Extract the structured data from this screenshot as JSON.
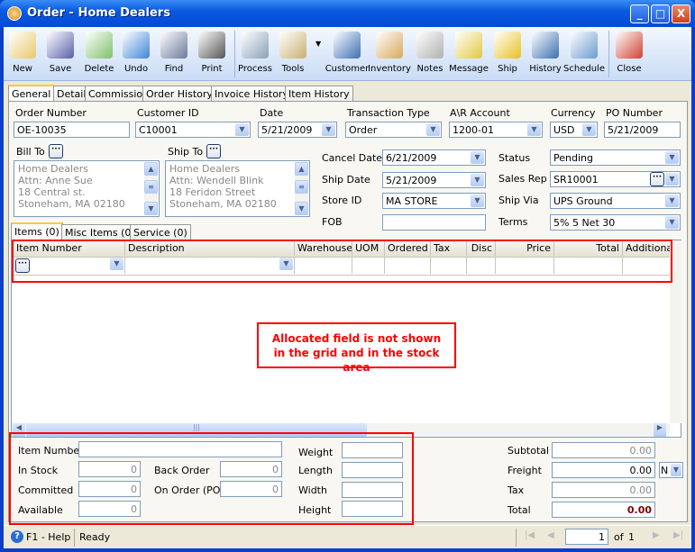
{
  "window": {
    "title": "Order - Home Dealers",
    "minimize": "_",
    "maximize": "□",
    "close": "X"
  },
  "toolbar": [
    {
      "label": "New",
      "icon": "new-document-icon",
      "color": "#e8c96a"
    },
    {
      "label": "Save",
      "icon": "floppy-disk-icon",
      "color": "#5a5fa8"
    },
    {
      "label": "Delete",
      "icon": "recycle-bin-icon",
      "color": "#7fbf6a"
    },
    {
      "label": "Undo",
      "icon": "undo-arrow-icon",
      "color": "#3f86d8"
    },
    {
      "label": "Find",
      "icon": "binoculars-icon",
      "color": "#6a7a9a"
    },
    {
      "label": "Print",
      "icon": "printer-icon",
      "color": "#555"
    },
    {
      "label": "Process",
      "icon": "process-gear-icon",
      "color": "#8aa0b8"
    },
    {
      "label": "Tools",
      "icon": "tools-icon",
      "color": "#c8b070"
    },
    {
      "label": "Customer",
      "icon": "customer-person-icon",
      "color": "#3a6fb0"
    },
    {
      "label": "Inventory",
      "icon": "boxes-icon",
      "color": "#d9a85a"
    },
    {
      "label": "Notes",
      "icon": "notepad-pen-icon",
      "color": "#b0b0b0"
    },
    {
      "label": "Message",
      "icon": "message-icon",
      "color": "#e0c840"
    },
    {
      "label": "Ship",
      "icon": "forklift-icon",
      "color": "#e8c020"
    },
    {
      "label": "History",
      "icon": "person-hourglass-icon",
      "color": "#3a6fb0"
    },
    {
      "label": "Schedule",
      "icon": "calendar-clock-icon",
      "color": "#6a9ad0"
    },
    {
      "label": "Close",
      "icon": "close-window-icon",
      "color": "#d04030"
    }
  ],
  "tabs": [
    "General",
    "Detail",
    "Commission",
    "Order History",
    "Invoice History",
    "Item History"
  ],
  "header": {
    "order_number_label": "Order Number",
    "order_number": "OE-10035",
    "customer_id_label": "Customer ID",
    "customer_id": "C10001",
    "date_label": "Date",
    "date": "5/21/2009",
    "transaction_type_label": "Transaction Type",
    "transaction_type": "Order",
    "ar_account_label": "A\\R Account",
    "ar_account": "1200-01",
    "currency_label": "Currency",
    "currency": "USD",
    "po_number_label": "PO Number",
    "po_number": "5/21/2009"
  },
  "bill_to": {
    "label": "Bill To",
    "lines": [
      "Home Dealers",
      "Attn: Anne Sue",
      "18 Central st.",
      "Stoneham, MA 02180"
    ]
  },
  "ship_to": {
    "label": "Ship To",
    "lines": [
      "Home Dealers",
      "Attn: Wendell Blink",
      "18 Feridon Street",
      "Stoneham, MA 02180"
    ]
  },
  "details": {
    "cancel_date_label": "Cancel  Date",
    "cancel_date": "6/21/2009",
    "ship_date_label": "Ship Date",
    "ship_date": "5/21/2009",
    "store_id_label": "Store ID",
    "store_id": "MA STORE",
    "fob_label": "FOB",
    "fob": "",
    "status_label": "Status",
    "status": "Pending",
    "sales_rep_label": "Sales Rep",
    "sales_rep": "SR10001",
    "ship_via_label": "Ship Via",
    "ship_via": "UPS Ground",
    "terms_label": "Terms",
    "terms": "5% 5 Net 30"
  },
  "item_tabs": [
    "Items (0)",
    "Misc Items (0)",
    "Service (0)"
  ],
  "grid": {
    "columns": [
      "Item Number",
      "Description",
      "Warehouse",
      "UOM",
      "Ordered",
      "Tax",
      "Disc",
      "Price",
      "Total",
      "Additional"
    ]
  },
  "annotation": "Allocated field is not shown in the grid and in the stock area",
  "annotation_color": "#ff0000",
  "stock": {
    "item_number_label": "Item Number",
    "item_number": "",
    "in_stock_label": "In Stock",
    "in_stock": "0",
    "committed_label": "Committed",
    "committed": "0",
    "available_label": "Available",
    "available": "0",
    "back_order_label": "Back Order",
    "back_order": "0",
    "on_order_label": "On Order (PO)",
    "on_order": "0",
    "weight_label": "Weight",
    "length_label": "Length",
    "width_label": "Width",
    "height_label": "Height"
  },
  "totals": {
    "subtotal_label": "Subtotal",
    "subtotal": "0.00",
    "freight_label": "Freight",
    "freight": "0.00",
    "freight_option": "N",
    "tax_label": "Tax",
    "tax": "0.00",
    "total_label": "Total",
    "total": "0.00",
    "total_color": "#800000"
  },
  "statusbar": {
    "help": "F1 - Help",
    "status": "Ready",
    "page": "1",
    "of_label": "of",
    "page_count": "1"
  }
}
